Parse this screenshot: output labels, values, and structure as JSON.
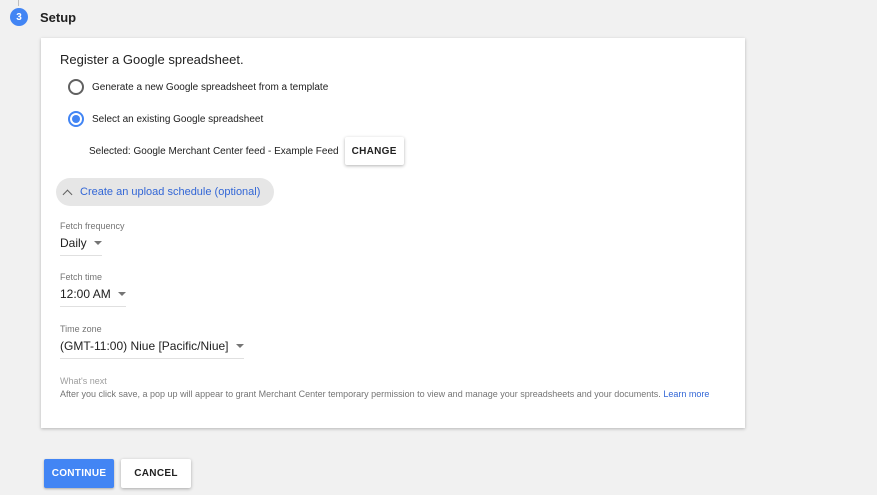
{
  "step": {
    "number": "3",
    "title": "Setup"
  },
  "card": {
    "heading": "Register a Google spreadsheet.",
    "options": [
      {
        "label": "Generate a new Google spreadsheet from a template",
        "checked": false
      },
      {
        "label": "Select an existing Google spreadsheet",
        "checked": true
      }
    ],
    "selected_text": "Selected: Google Merchant Center feed - Example Feed",
    "change_label": "CHANGE",
    "schedule_toggle": "Create an upload schedule (optional)",
    "fetch_frequency": {
      "label": "Fetch frequency",
      "value": "Daily"
    },
    "fetch_time": {
      "label": "Fetch time",
      "value": "12:00 AM"
    },
    "time_zone": {
      "label": "Time zone",
      "value": "(GMT-11:00) Niue [Pacific/Niue]"
    },
    "whats_next": {
      "title": "What's next",
      "text": "After you click save, a pop up will appear to grant Merchant Center temporary permission to view and manage your spreadsheets and your documents.",
      "link": "Learn more"
    }
  },
  "actions": {
    "continue_label": "CONTINUE",
    "cancel_label": "CANCEL"
  },
  "colors": {
    "accent": "#4285f4",
    "link": "#3367d6",
    "background": "#f1f1f1"
  }
}
